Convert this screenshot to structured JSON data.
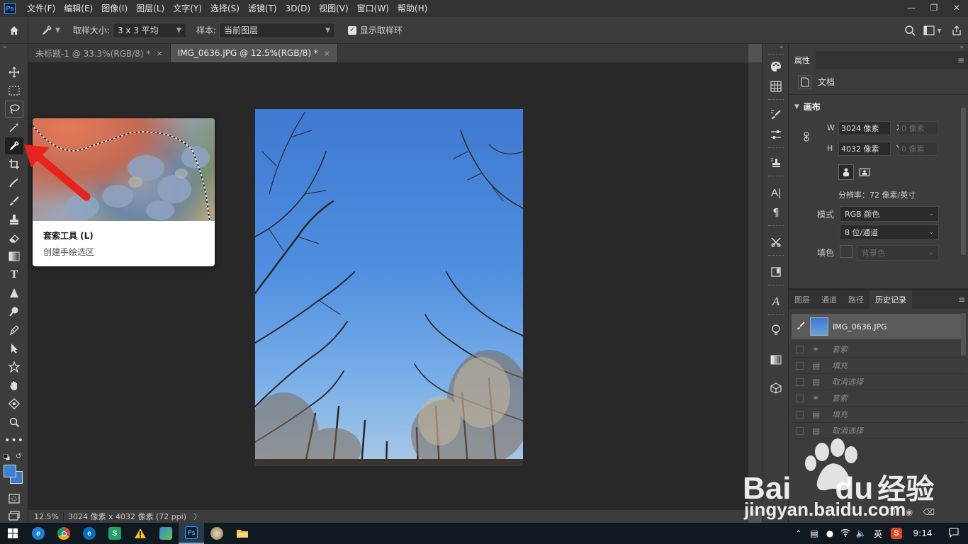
{
  "app": {
    "logo": "Ps",
    "menu": [
      "文件(F)",
      "编辑(E)",
      "图像(I)",
      "图层(L)",
      "文字(Y)",
      "选择(S)",
      "滤镜(T)",
      "3D(D)",
      "视图(V)",
      "窗口(W)",
      "帮助(H)"
    ]
  },
  "options": {
    "sample_size_label": "取样大小:",
    "sample_size_value": "3 x 3 平均",
    "sample_label": "样本:",
    "sample_value": "当前图层",
    "show_ring_label": "显示取样环"
  },
  "tabs": [
    {
      "label": "未标题-1 @ 33.3%(RGB/8) *",
      "close": "×"
    },
    {
      "label": "IMG_0636.JPG @ 12.5%(RGB/8) *",
      "close": "×"
    }
  ],
  "tooltip": {
    "title": "套索工具 (L)",
    "description": "创建手绘选区"
  },
  "status": {
    "zoom": "12.5%",
    "doc_info": "3024 像素 x 4032 像素 (72 ppi)",
    "arrow": "〉"
  },
  "properties": {
    "tab_label": "属性",
    "doc_label": "文档",
    "canvas_section": "画布",
    "w_label": "W",
    "w_value": "3024 像素",
    "h_label": "H",
    "h_value": "4032 像素",
    "x_label": "X",
    "x_placeholder": "0 像素",
    "y_label": "Y",
    "y_placeholder": "0 像素",
    "resolution": "分辨率：72 像素/英寸",
    "mode_label": "模式",
    "mode_value": "RGB 颜色",
    "depth_value": "8 位/通道",
    "fill_label": "填色",
    "fill_value": "背景色"
  },
  "history_panel": {
    "tabs": [
      "图层",
      "通道",
      "路径",
      "历史记录"
    ],
    "snapshot_name": "IMG_0636.JPG",
    "items": [
      {
        "icon": "lasso-icon",
        "label": "套索"
      },
      {
        "icon": "fill-icon",
        "label": "填充"
      },
      {
        "icon": "deselect-icon",
        "label": "取消选择"
      },
      {
        "icon": "lasso-icon",
        "label": "套索"
      },
      {
        "icon": "fill-icon",
        "label": "填充"
      },
      {
        "icon": "deselect-icon",
        "label": "取消选择"
      }
    ]
  },
  "taskbar": {
    "ime": "英",
    "clock": "9:14"
  },
  "watermark": {
    "brand": "Bai",
    "brand_du": "du",
    "chinese": "经验",
    "url": "jingyan.baidu.com"
  },
  "colors": {
    "foreground": "#3d7fd0",
    "background": "#3a7ac4",
    "accent": "#31a8ff",
    "arrow": "#e8231c"
  }
}
